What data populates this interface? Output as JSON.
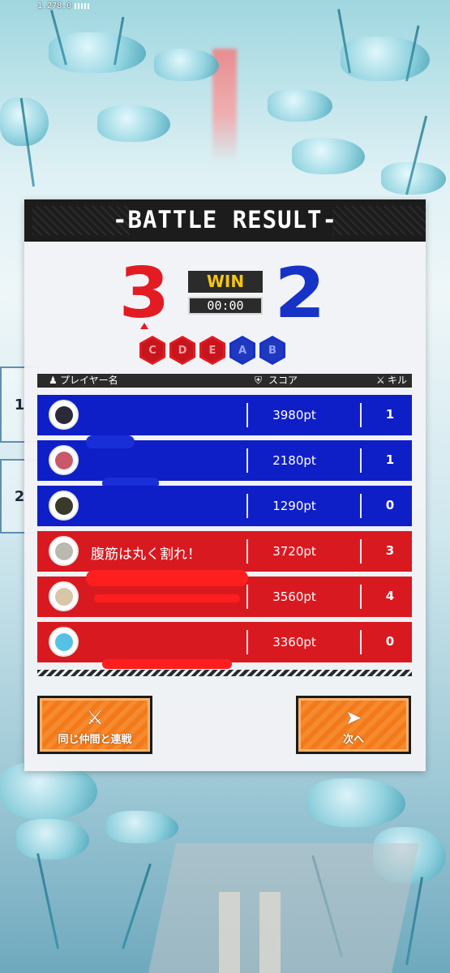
{
  "status_bar": {
    "version": "1.278.0"
  },
  "header": {
    "title": "-BATTLE RESULT-"
  },
  "match": {
    "red_score": "3",
    "blue_score": "2",
    "result": "WIN",
    "time": "00:00",
    "points": [
      {
        "team": "red",
        "label": "C"
      },
      {
        "team": "red",
        "label": "D"
      },
      {
        "team": "red",
        "label": "E"
      },
      {
        "team": "blue",
        "label": "A"
      },
      {
        "team": "blue",
        "label": "B"
      }
    ]
  },
  "side_markers": [
    "1",
    "2"
  ],
  "table": {
    "columns": {
      "player": "プレイヤー名",
      "score": "スコア",
      "kill": "キル"
    },
    "rows": [
      {
        "team": "blue",
        "name": "",
        "score": "3980pt",
        "kill": "1",
        "avatar_color": "#2a2a3a"
      },
      {
        "team": "blue",
        "name": "",
        "score": "2180pt",
        "kill": "1",
        "avatar_color": "#c9586a"
      },
      {
        "team": "blue",
        "name": "",
        "score": "1290pt",
        "kill": "0",
        "avatar_color": "#3a3a2a"
      },
      {
        "team": "red",
        "name": "腹筋は丸く割れ！",
        "score": "3720pt",
        "kill": "3",
        "avatar_color": "#b9b9b0"
      },
      {
        "team": "red",
        "name": "",
        "score": "3560pt",
        "kill": "4",
        "avatar_color": "#d9c6a8"
      },
      {
        "team": "red",
        "name": "",
        "score": "3360pt",
        "kill": "0",
        "avatar_color": "#57c0e6"
      }
    ]
  },
  "buttons": {
    "rematch_label": "同じ仲間と連戦",
    "rematch_icon": "crossed-swords-icon",
    "next_label": "次へ",
    "next_icon": "arrow-right-icon"
  },
  "colors": {
    "red_team": "#d91920",
    "blue_team": "#0f1fc7",
    "button_orange": "#f37a1b",
    "win_yellow": "#f3c414"
  }
}
